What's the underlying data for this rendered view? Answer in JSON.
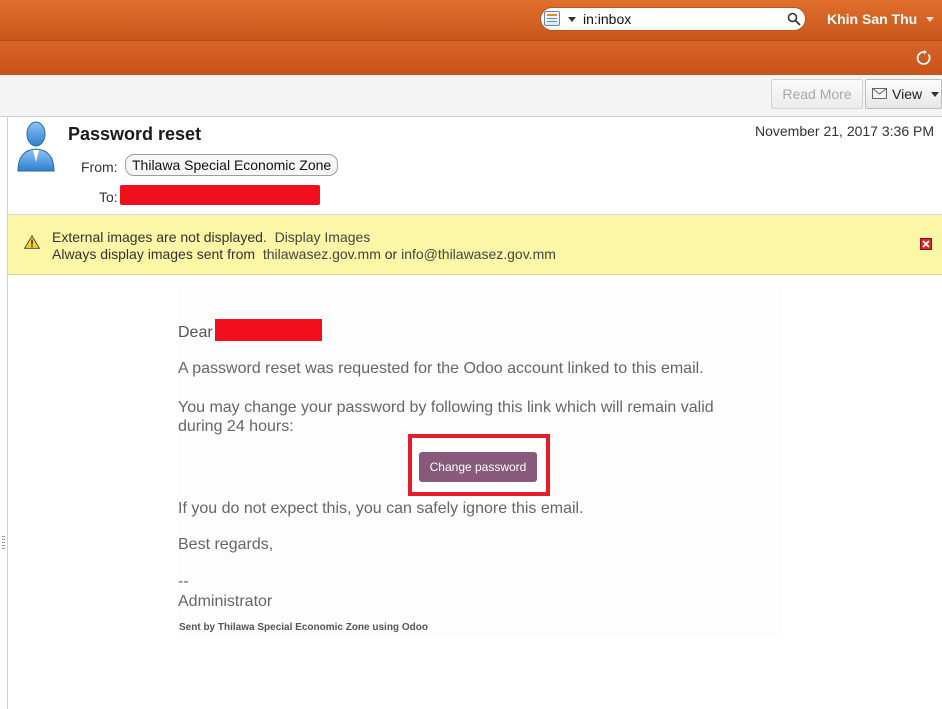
{
  "search": {
    "query": "in:inbox"
  },
  "user": {
    "name": "Khin San Thu"
  },
  "toolbar": {
    "read_more": "Read More",
    "view": "View"
  },
  "message": {
    "subject": "Password reset",
    "date": "November 21, 2017 3:36 PM",
    "from_label": "From:",
    "from": "Thilawa Special Economic Zone",
    "to_label": "To:"
  },
  "warning": {
    "text": "External images are not displayed.",
    "display_images": "Display Images",
    "always_prefix": "Always display images sent from",
    "domain": "thilawasez.gov.mm",
    "or": "or",
    "email": "info@thilawasez.gov.mm"
  },
  "body": {
    "greeting": "Dear",
    "para1": "A password reset was requested for the Odoo account linked to this email.",
    "para2": "You may change your password by following this link which will remain valid during 24 hours:",
    "button": "Change password",
    "para3": "If you do not expect this, you can safely ignore this email.",
    "regards": "Best regards,",
    "sig_dash": "--",
    "signature": "Administrator",
    "sent_by": "Sent by Thilawa Special Economic Zone using Odoo"
  },
  "colors": {
    "accent": "#d7632a",
    "button": "#875a7b",
    "highlight": "#e51d2a",
    "warning_bg": "#fbf7a6"
  }
}
